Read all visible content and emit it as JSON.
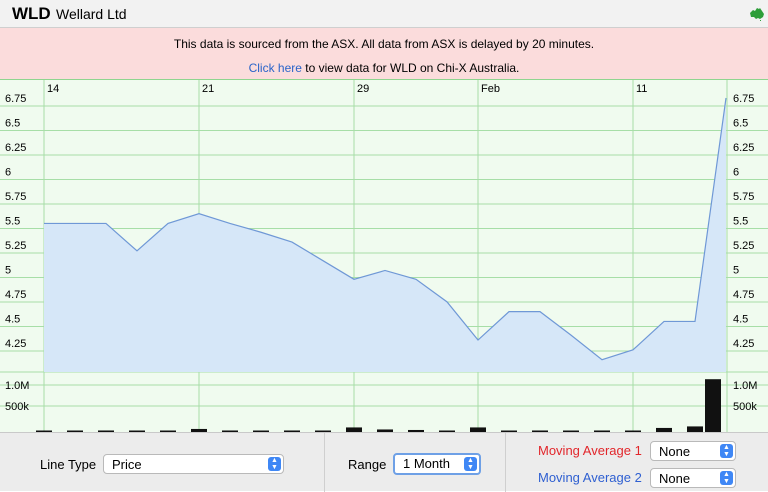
{
  "header": {
    "code": "WLD",
    "company": "Wellard Ltd",
    "flag_icon": "australia-map-icon"
  },
  "notice": {
    "line1": "This data is sourced from the ASX. All data from ASX is delayed by 20 minutes.",
    "link_text": "Click here",
    "line2_rest": " to view data for WLD on Chi-X Australia."
  },
  "chart_data": {
    "type": "area",
    "x_ticks": [
      "14",
      "21",
      "29",
      "Feb",
      "11"
    ],
    "y_ticks": [
      "6.75",
      "6.5",
      "6.25",
      "6",
      "5.75",
      "5.5",
      "5.25",
      "5",
      "4.75",
      "4.5",
      "4.25"
    ],
    "ylim": [
      4.0,
      6.75
    ],
    "price_series": [
      5.47,
      5.47,
      5.47,
      5.19,
      5.47,
      5.57,
      5.47,
      5.38,
      5.28,
      5.09,
      4.9,
      4.99,
      4.9,
      4.67,
      4.28,
      4.57,
      4.57,
      4.33,
      4.08,
      4.18,
      4.47,
      4.47,
      6.75
    ],
    "volume_ticks": [
      "1.0M",
      "500k"
    ],
    "volume_max": 1300000,
    "volume_series": [
      20000,
      10000,
      30000,
      20000,
      20000,
      60000,
      30000,
      10000,
      30000,
      10000,
      90000,
      50000,
      40000,
      20000,
      90000,
      20000,
      30000,
      20000,
      30000,
      20000,
      80000,
      110000,
      1040000
    ],
    "grid": true,
    "line_color": "#6f98d6",
    "fill_color": "#d6e7f8",
    "grid_color": "#a7dea7",
    "bg_color": "#f0fbef"
  },
  "controls": {
    "line_type_label": "Line Type",
    "line_type_value": "Price",
    "range_label": "Range",
    "range_value": "1 Month",
    "ma1_label": "Moving Average 1",
    "ma1_value": "None",
    "ma2_label": "Moving Average 2",
    "ma2_value": "None",
    "ma1_color": "#e2262b",
    "ma2_color": "#2e5fd1"
  }
}
